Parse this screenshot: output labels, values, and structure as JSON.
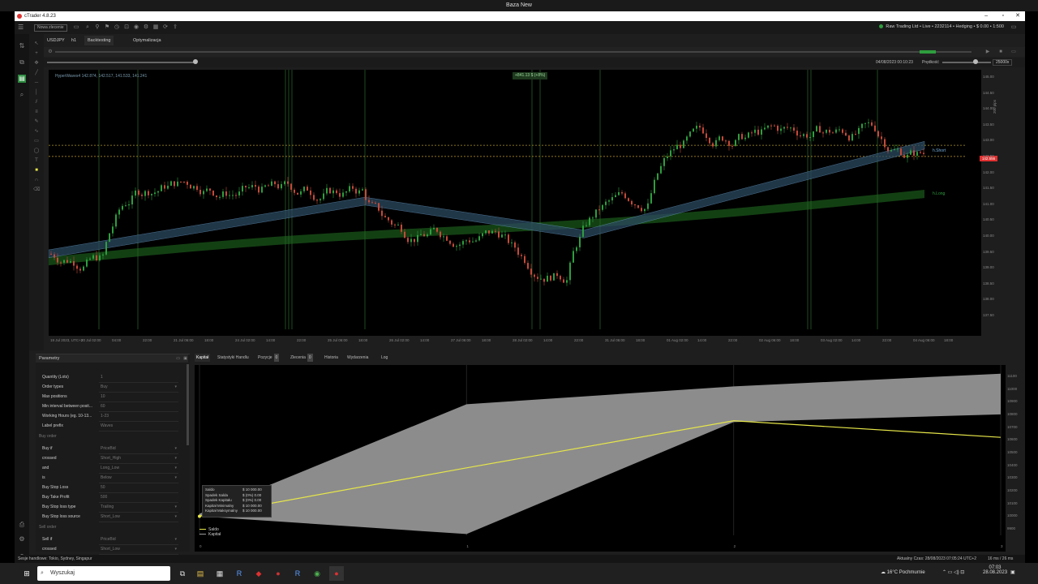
{
  "outer_window": {
    "title": "Baza New"
  },
  "app_window": {
    "title": "cTrader 4.8.23"
  },
  "menubar": {
    "new_menu_label": "Nowa zlecenie",
    "account": "Raw Trading Ltd • Live • 2232114 • Hedging • $ 0.00 • 1:500"
  },
  "tabs": [
    {
      "label": "USDJPY"
    },
    {
      "label": "h1"
    },
    {
      "label": "Backtesting"
    },
    {
      "label": "Optymalizacja"
    }
  ],
  "backtest": {
    "end_date_time": "04/08/2023 00:10:23",
    "speed_label": "Prędkość",
    "speed_value": "25000x"
  },
  "chart": {
    "indicator_label": "HyperWaves4 142.874, 142.517, 141.533, 141.241",
    "pnl_label": "+841.13 $ (+8%)",
    "short_label": "h.Short",
    "long_label": "h.Long",
    "price_tag": "142.556",
    "volume_label": "200 pips",
    "y_ticks": [
      "145.00",
      "144.50",
      "144.00",
      "143.50",
      "143.00",
      "142.50",
      "142.00",
      "141.50",
      "141.00",
      "140.50",
      "140.00",
      "139.50",
      "139.00",
      "138.50",
      "138.00",
      "137.50"
    ],
    "x_ticks": [
      "19 Jul 2023, UTC+2",
      "20 Jul 02:00",
      "04:00",
      "22:00",
      "21 Jul 06:00",
      "18:00",
      "24 Jul 02:00",
      "14:00",
      "22:00",
      "25 Jul 06:00",
      "18:00",
      "26 Jul 02:00",
      "14:00",
      "27 Jul 06:00",
      "18:00",
      "28 Jul 02:00",
      "14:00",
      "22:00",
      "31 Jul 06:00",
      "18:00",
      "01 Aug 02:00",
      "14:00",
      "22:00",
      "02 Aug 06:00",
      "18:00",
      "03 Aug 02:00",
      "14:00",
      "22:00",
      "04 Aug 06:00",
      "18:00"
    ]
  },
  "params_panel": {
    "title": "Parametry",
    "rows": [
      {
        "label": "Quantity (Lots)",
        "value": "1",
        "select": false
      },
      {
        "label": "Order types",
        "value": "Buy",
        "select": true
      },
      {
        "label": "Max positions",
        "value": "10",
        "select": false
      },
      {
        "label": "Min interval between posit...",
        "value": "60",
        "select": false
      },
      {
        "label": "Working Hours (eg. 10-13...",
        "value": "1-23",
        "select": false
      },
      {
        "label": "Label prefix",
        "value": "Waves",
        "select": false
      }
    ],
    "section_buy": "Buy order",
    "buy_rows": [
      {
        "label": "Buy if",
        "value": "PriceBid",
        "select": true
      },
      {
        "label": "crossed",
        "value": "Short_High",
        "select": true
      },
      {
        "label": "and",
        "value": "Long_Low",
        "select": true
      },
      {
        "label": "is",
        "value": "Below",
        "select": true
      },
      {
        "label": "Buy Stop Loss",
        "value": "50",
        "select": false
      },
      {
        "label": "Buy Take Profit",
        "value": "500",
        "select": false
      },
      {
        "label": "Buy Stop loss type",
        "value": "Trailing",
        "select": true
      },
      {
        "label": "Buy Stop loss source",
        "value": "Short_Low",
        "select": true
      }
    ],
    "section_sell": "Sell order",
    "sell_rows": [
      {
        "label": "Sell if",
        "value": "PriceBid",
        "select": true
      },
      {
        "label": "crossed",
        "value": "Short_Low",
        "select": true
      }
    ]
  },
  "bottom_tabs": [
    {
      "label": "Kapitał",
      "badge": ""
    },
    {
      "label": "Statystyki Handlu",
      "badge": ""
    },
    {
      "label": "Pozycje",
      "badge": "0"
    },
    {
      "label": "Zlecenia",
      "badge": "0"
    },
    {
      "label": "Historia",
      "badge": ""
    },
    {
      "label": "Wydarzenia",
      "badge": ""
    },
    {
      "label": "Log",
      "badge": ""
    }
  ],
  "equity": {
    "tooltip": [
      {
        "label": "Saldo",
        "value": "$ 10 000.00"
      },
      {
        "label": "Spadek Salda",
        "value": "$ (0%) 0.00"
      },
      {
        "label": "Spadek Kapitału",
        "value": "$ (0%) 0.00"
      },
      {
        "label": "Kapitał Minimalny",
        "value": "$ 10 000.00"
      },
      {
        "label": "Kapitał Maksymalny",
        "value": "$ 10 000.00"
      }
    ],
    "legend": [
      {
        "name": "Saldo",
        "color": "#e6e64a"
      },
      {
        "name": "Kapitał",
        "color": "#9a9a9a"
      }
    ],
    "y_ticks": [
      "11100",
      "11000",
      "10900",
      "10800",
      "10700",
      "10600",
      "10500",
      "10400",
      "10300",
      "10200",
      "10100",
      "10000",
      "9900"
    ],
    "x_ticks": [
      "0",
      "1",
      "2",
      "3"
    ],
    "balance": [
      10000,
      10380,
      10750,
      10620
    ],
    "equity_high": [
      10020,
      10880,
      11020,
      11120
    ],
    "equity_low": [
      10000,
      9860,
      10740,
      10800
    ]
  },
  "statusbar": {
    "session": "Sesje handlowe: Tokio, Sydney, Singapur",
    "time": "Aktualny Czas: 28/08/2023 07:05:24  UTC+2",
    "latency": "16 ms / 26 ms"
  },
  "taskbar": {
    "search": "Wyszukaj",
    "weather": "16°C  Pochmurnie",
    "clock_time": "07:03",
    "clock_date": "28.08.2023"
  },
  "colors": {
    "accent_green": "#2e9e3e",
    "short_band": "#7ab0e0",
    "long_band": "#1f6a1f",
    "bull_candle": "#2e9e3e",
    "bear_candle": "#c44a3a",
    "balance_line": "#e6e64a"
  }
}
